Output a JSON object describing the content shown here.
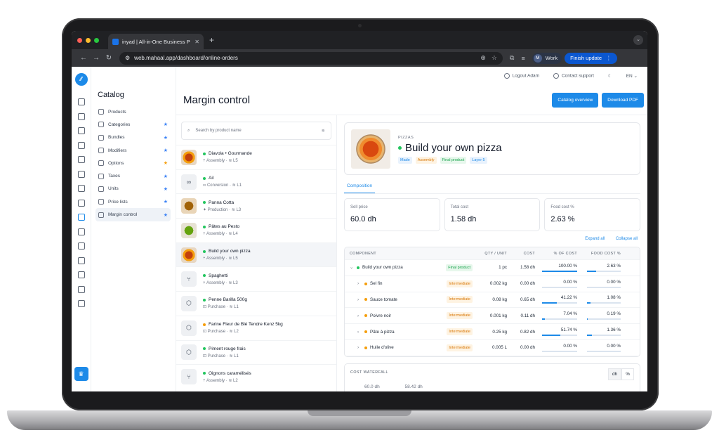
{
  "browser": {
    "tab_title": "inyad | All-in-One Business P",
    "url": "web.mahaal.app/dashboard/online-orders",
    "profile_initial": "M",
    "profile_name": "Work",
    "update_label": "Finish update"
  },
  "topbar": {
    "logout": "Logout Adam",
    "support": "Contact support",
    "language": "EN"
  },
  "catalog": {
    "title": "Catalog",
    "items": [
      {
        "label": "Products",
        "pin": ""
      },
      {
        "label": "Categories",
        "pin": "★"
      },
      {
        "label": "Bundles",
        "pin": "★"
      },
      {
        "label": "Modifiers",
        "pin": "★"
      },
      {
        "label": "Options",
        "pin": "★"
      },
      {
        "label": "Taxes",
        "pin": "★"
      },
      {
        "label": "Units",
        "pin": "★"
      },
      {
        "label": "Price lists",
        "pin": "★"
      },
      {
        "label": "Margin control",
        "pin": "★"
      }
    ]
  },
  "page": {
    "title": "Margin control",
    "btn_overview": "Catalog overview",
    "btn_pdf": "Download PDF"
  },
  "search": {
    "placeholder": "Search by product name"
  },
  "products": [
    {
      "name": "Diavola • Gourmande",
      "type": "Assembly",
      "level": "L5"
    },
    {
      "name": "Ail",
      "type": "Conversion",
      "level": "L1"
    },
    {
      "name": "Panna Cotta",
      "type": "Production",
      "level": "L3"
    },
    {
      "name": "Pâtes au Pesto",
      "type": "Assembly",
      "level": "L4"
    },
    {
      "name": "Build your own pizza",
      "type": "Assembly",
      "level": "L5"
    },
    {
      "name": "Spaghetti",
      "type": "Assembly",
      "level": "L3"
    },
    {
      "name": "Penne Barilla 500g",
      "type": "Purchase",
      "level": "L1"
    },
    {
      "name": "Farine Fleur de Blé Tendre Kenz 5kg",
      "type": "Purchase",
      "level": "L2"
    },
    {
      "name": "Piment rouge frais",
      "type": "Purchase",
      "level": "L1"
    },
    {
      "name": "Oignons caramélisés",
      "type": "Assembly",
      "level": "L2"
    }
  ],
  "detail": {
    "category": "PIZZAS",
    "title": "Build your own pizza",
    "tags": [
      "Made",
      "Assembly",
      "Final product",
      "Layer 5"
    ],
    "tab": "Composition",
    "stats": [
      {
        "label": "Sell price",
        "value": "60.0 dh"
      },
      {
        "label": "Total cost",
        "value": "1.58 dh"
      },
      {
        "label": "Food cost %",
        "value": "2.63 %"
      }
    ],
    "expand_all": "Expand all",
    "collapse_all": "Collapse all"
  },
  "table": {
    "headers": [
      "COMPONENT",
      "QTY / UNIT",
      "COST",
      "% OF COST",
      "FOOD COST %"
    ],
    "rows": [
      {
        "chev": "⌄",
        "name": "Build your own pizza",
        "badge": "Final product",
        "qty": "1 pc",
        "cost": "1.58 dh",
        "pct": "100.00 %",
        "pct_v": 100,
        "food": "2.63 %",
        "food_v": 2.63
      },
      {
        "chev": "›",
        "name": "Sel fin",
        "badge": "Intermediate",
        "qty": "0.002 kg",
        "cost": "0.00 dh",
        "pct": "0.00 %",
        "pct_v": 0,
        "food": "0.00 %",
        "food_v": 0
      },
      {
        "chev": "›",
        "name": "Sauce tomate",
        "badge": "Intermediate",
        "qty": "0.08 kg",
        "cost": "0.65 dh",
        "pct": "41.22 %",
        "pct_v": 41.22,
        "food": "1.08 %",
        "food_v": 1.08
      },
      {
        "chev": "›",
        "name": "Poivre noir",
        "badge": "Intermediate",
        "qty": "0.001 kg",
        "cost": "0.11 dh",
        "pct": "7.04 %",
        "pct_v": 7.04,
        "food": "0.19 %",
        "food_v": 0.19
      },
      {
        "chev": "›",
        "name": "Pâte à pizza",
        "badge": "Intermediate",
        "qty": "0.25 kg",
        "cost": "0.82 dh",
        "pct": "51.74 %",
        "pct_v": 51.74,
        "food": "1.36 %",
        "food_v": 1.36
      },
      {
        "chev": "›",
        "name": "Huile d'olive",
        "badge": "Intermediate",
        "qty": "0.005 L",
        "cost": "0.00 dh",
        "pct": "0.00 %",
        "pct_v": 0,
        "food": "0.00 %",
        "food_v": 0
      }
    ]
  },
  "waterfall": {
    "label": "COST WATERFALL",
    "toggle": [
      "dh",
      "%"
    ],
    "values": [
      "60.0 dh",
      "58.42 dh"
    ]
  },
  "colors": {
    "accent": "#1d8ae8",
    "active_dot": "#22c55e",
    "intermediate": "#f59e0b"
  }
}
